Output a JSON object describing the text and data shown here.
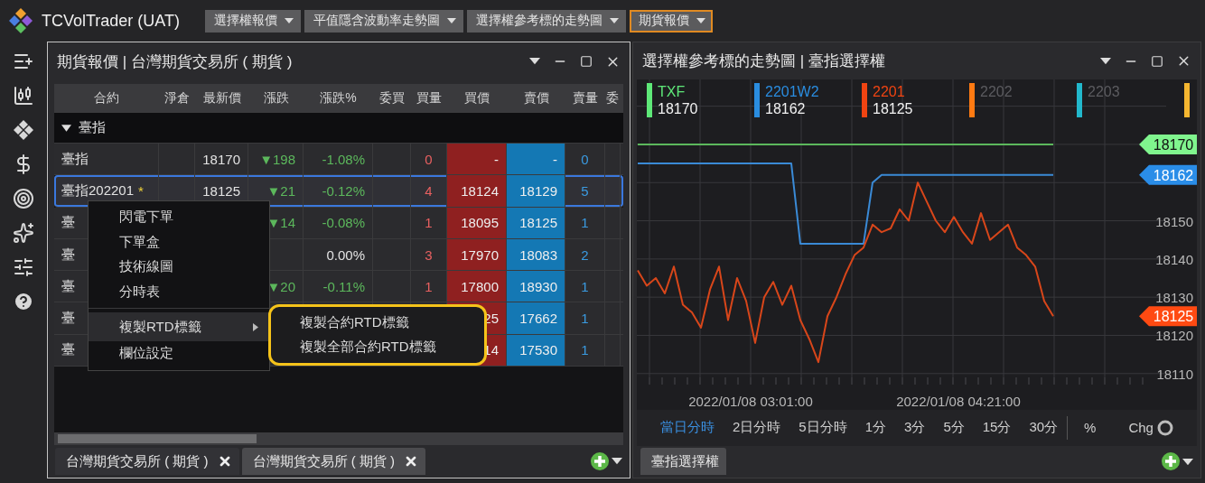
{
  "app": {
    "title": "TCVolTrader (UAT)",
    "tabs": [
      {
        "label": "選擇權報價",
        "selected": false
      },
      {
        "label": "平值隱含波動率走勢圖",
        "selected": false
      },
      {
        "label": "選擇權參考標的走勢圖",
        "selected": false
      },
      {
        "label": "期貨報價",
        "selected": true
      }
    ]
  },
  "left_panel": {
    "title": "期貨報價 | 台灣期貨交易所 ( 期貨 )",
    "table": {
      "columns": [
        {
          "label": "合約",
          "kind": "name"
        },
        {
          "label": "淨倉",
          "kind": "plain"
        },
        {
          "label": "最新價",
          "kind": "plain"
        },
        {
          "label": "漲跌",
          "kind": "change"
        },
        {
          "label": "漲跌%",
          "kind": "change"
        },
        {
          "label": "委買",
          "kind": "plain"
        },
        {
          "label": "買量",
          "kind": "bidvol"
        },
        {
          "label": "買價",
          "kind": "bid"
        },
        {
          "label": "賣價",
          "kind": "ask"
        },
        {
          "label": "賣量",
          "kind": "askvol"
        },
        {
          "label": "委",
          "kind": "cut"
        }
      ],
      "group": {
        "label": "臺指",
        "expanded": true
      },
      "rows": [
        {
          "cells": [
            "臺指",
            null,
            "18170",
            "▼198",
            "-1.08%",
            null,
            "0",
            "-",
            "-",
            "0",
            null
          ],
          "color": "#5cb85c",
          "selected": false
        },
        {
          "cells": [
            "臺指202201",
            null,
            "18125",
            "▼21",
            "-0.12%",
            null,
            "4",
            "18124",
            "18129",
            "5",
            null
          ],
          "flag": "*",
          "color": "#5cb85c",
          "selected": true
        },
        {
          "cells": [
            "臺",
            null,
            null,
            "▼14",
            "-0.08%",
            null,
            "1",
            "18095",
            "18125",
            "1",
            null
          ],
          "color": "#5cb85c",
          "selected": false
        },
        {
          "cells": [
            "臺",
            null,
            null,
            null,
            "0.00%",
            null,
            "3",
            "17970",
            "18083",
            "2",
            null
          ],
          "color": "#e2e2e2",
          "selected": false
        },
        {
          "cells": [
            "臺",
            null,
            null,
            "▼20",
            "-0.11%",
            null,
            "1",
            "17800",
            "18930",
            "1",
            null
          ],
          "color": "#5cb85c",
          "selected": false
        },
        {
          "cells": [
            "臺",
            null,
            null,
            null,
            null,
            null,
            null,
            "25",
            "17662",
            "1",
            null
          ],
          "selected": false
        },
        {
          "cells": [
            "臺",
            null,
            null,
            null,
            null,
            null,
            null,
            "14",
            "17530",
            "1",
            null
          ],
          "selected": false
        }
      ]
    },
    "context_menu": {
      "items": [
        {
          "kind": "item",
          "label": "閃電下單",
          "highlighted": false
        },
        {
          "kind": "item",
          "label": "下單盒",
          "highlighted": false
        },
        {
          "kind": "item",
          "label": "技術線圖",
          "highlighted": false
        },
        {
          "kind": "item",
          "label": "分時表",
          "highlighted": false
        },
        {
          "kind": "separator"
        },
        {
          "kind": "submenu",
          "label": "複製RTD標籤",
          "highlighted": true
        },
        {
          "kind": "item",
          "label": "欄位設定",
          "highlighted": false
        }
      ],
      "submenu": [
        {
          "label": "複製合約RTD標籤",
          "highlighted": false
        },
        {
          "label": "複製全部合約RTD標籤",
          "highlighted": false
        }
      ]
    },
    "tabs": [
      {
        "label": "台灣期貨交易所 ( 期貨 )",
        "selected": false
      },
      {
        "label": "台灣期貨交易所 ( 期貨 )",
        "selected": true
      }
    ]
  },
  "right_panel": {
    "title": "選擇權參考標的走勢圖 | 臺指選擇權",
    "legend": [
      {
        "name": "TXF",
        "value": "18170",
        "color": "#5ee878",
        "active": true
      },
      {
        "name": "2201W2",
        "value": "18162",
        "color": "#2a8de0",
        "active": true
      },
      {
        "name": "2201",
        "value": "18125",
        "color": "#f04412",
        "active": true
      },
      {
        "name": "2202",
        "color": "#ff7a12",
        "active": false
      },
      {
        "name": "2203",
        "color": "#22b8cc",
        "active": false
      },
      {
        "color": "#f5b630"
      }
    ],
    "chart_data": {
      "type": "line",
      "categories": [
        null,
        null,
        null,
        null,
        null,
        null,
        null,
        null,
        null,
        null,
        null,
        null,
        "2022/01/08 03:01:00",
        null,
        null,
        null,
        null,
        null,
        null,
        null,
        null,
        null,
        null,
        null,
        null,
        null,
        null,
        null,
        null,
        null,
        null,
        null,
        null,
        null,
        null,
        "2022/01/08 04:21:00",
        null,
        null,
        null,
        null,
        null,
        null,
        null,
        null,
        null,
        null,
        null
      ],
      "ylim": [
        18109,
        18187
      ],
      "yticks": [
        18110,
        18120,
        18130,
        18140,
        18150
      ],
      "grid": true,
      "series": [
        {
          "color": "#5cb85c",
          "values": [
            18170,
            18170,
            18170,
            18170,
            18170,
            18170,
            18170,
            18170,
            18170,
            18170,
            18170,
            18170,
            18170,
            18170,
            18170,
            18170,
            18170,
            18170,
            18170,
            18170,
            18170,
            18170,
            18170,
            18170,
            18170,
            18170,
            18170,
            18170,
            18170,
            18170,
            18170,
            18170,
            18170,
            18170,
            18170,
            18170,
            18170,
            18170,
            18170,
            18170,
            18170,
            18170,
            18170,
            18170,
            18170,
            18170,
            18170
          ]
        },
        {
          "color": "#3a8ad6",
          "values": [
            18165,
            18165,
            18165,
            18165,
            18165,
            18165,
            18165,
            18165,
            18165,
            18165,
            18165,
            18165,
            18165,
            18165,
            18165,
            18165,
            18165,
            18165,
            18144,
            18144,
            18144,
            18144,
            18144,
            18144,
            18144,
            18144,
            18160,
            18162,
            18162,
            18162,
            18162,
            18162,
            18162,
            18162,
            18162,
            18162,
            18162,
            18162,
            18162,
            18162,
            18162,
            18162,
            18162,
            18162,
            18162,
            18162,
            18162
          ]
        },
        {
          "color": "#d8461a",
          "values": [
            18137,
            18133,
            18135,
            18131,
            18138,
            18128,
            18126,
            18122,
            18132,
            18138,
            18124,
            18135,
            18129,
            18118,
            18130,
            18134,
            18128,
            18133,
            18124,
            18119,
            18113,
            18125,
            18130,
            18136,
            18141,
            18143,
            18149,
            18147,
            18148,
            18153,
            18150,
            18160,
            18155,
            18150,
            18147,
            18151,
            18147,
            18144,
            18152,
            18145,
            18147,
            18149,
            18143,
            18141,
            18138,
            18129,
            18125
          ]
        }
      ]
    },
    "price_tags": [
      {
        "label": "18170",
        "color": "#80f58e"
      },
      {
        "label": "18162",
        "color": "#2a8de8"
      },
      {
        "label": "18125",
        "color": "#ff4a12"
      }
    ],
    "timeframes": [
      {
        "label": "當日分時",
        "selected": true
      },
      {
        "label": "2日分時",
        "selected": false
      },
      {
        "label": "5日分時",
        "selected": false
      },
      {
        "label": "1分",
        "selected": false
      },
      {
        "label": "3分",
        "selected": false
      },
      {
        "label": "5分",
        "selected": false
      },
      {
        "label": "15分",
        "selected": false
      },
      {
        "label": "30分",
        "selected": false
      }
    ],
    "modes": [
      "%",
      "Chg"
    ],
    "tabs": [
      {
        "label": "臺指選擇權",
        "selected": true
      }
    ]
  }
}
